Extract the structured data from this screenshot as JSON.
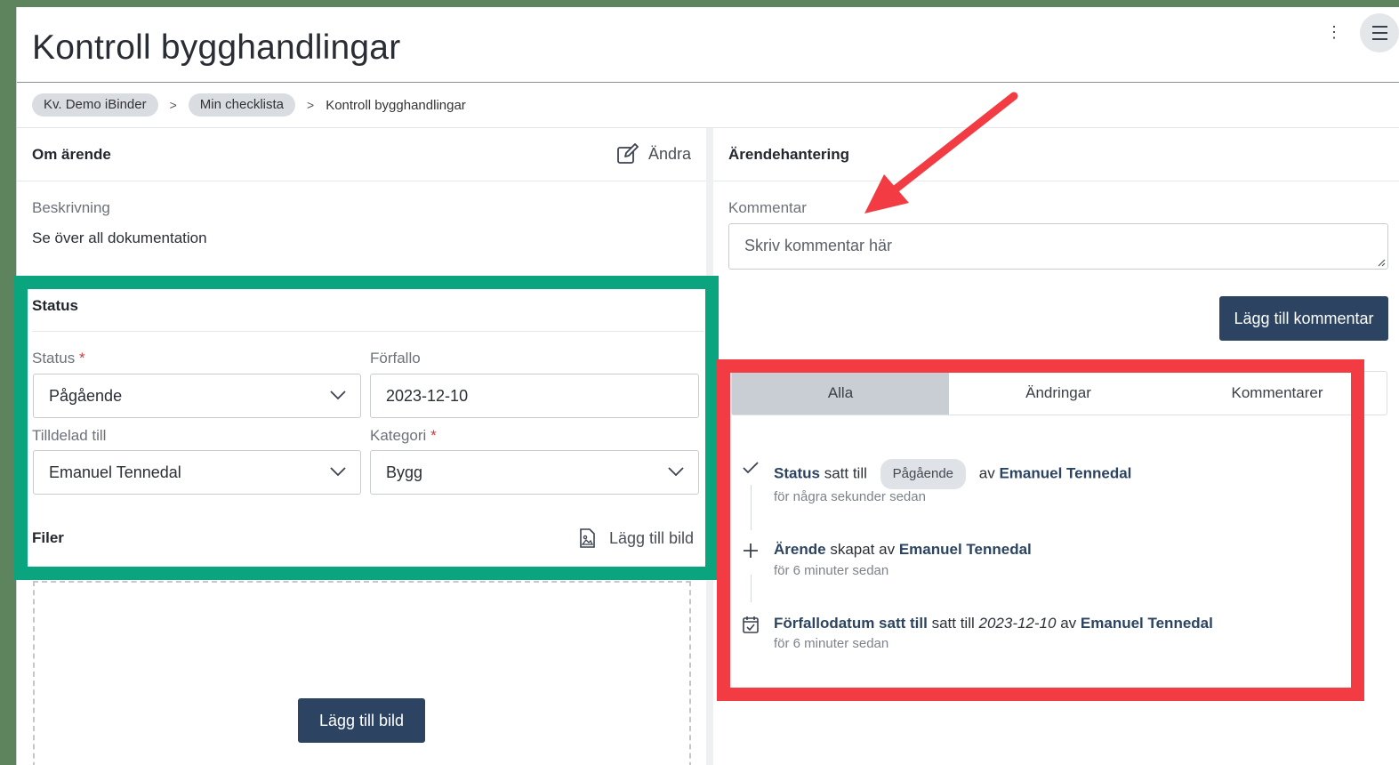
{
  "header": {
    "title": "Kontroll bygghandlingar",
    "more_icon_glyph": "⋮"
  },
  "breadcrumb": {
    "items": [
      "Kv. Demo iBinder",
      "Min checklista"
    ],
    "current": "Kontroll bygghandlingar",
    "separator": ">"
  },
  "about": {
    "heading": "Om ärende",
    "edit_label": "Ändra",
    "description_label": "Beskrivning",
    "description_value": "Se över all dokumentation"
  },
  "status_section": {
    "heading": "Status",
    "status_label": "Status",
    "status_value": "Pågående",
    "due_label": "Förfallo",
    "due_value": "2023-12-10",
    "assigned_label": "Tilldelad till",
    "assigned_value": "Emanuel Tennedal",
    "category_label": "Kategori",
    "category_value": "Bygg",
    "required_mark": "*"
  },
  "files": {
    "heading": "Filer",
    "add_image_link": "Lägg till bild",
    "add_image_button": "Lägg till bild"
  },
  "case_handling": {
    "heading": "Ärendehantering",
    "comment_label": "Kommentar",
    "comment_placeholder": "Skriv kommentar här",
    "add_comment_button": "Lägg till kommentar"
  },
  "tabs": [
    "Alla",
    "Ändringar",
    "Kommentarer"
  ],
  "activity": [
    {
      "icon": "check-icon",
      "subject": "Status",
      "verb": "satt till",
      "badge": "Pågående",
      "by_prefix": "av",
      "user": "Emanuel Tennedal",
      "time": "för några sekunder sedan"
    },
    {
      "icon": "plus-icon",
      "subject": "Ärende",
      "verb": "skapat av",
      "user": "Emanuel Tennedal",
      "time": "för 6 minuter sedan"
    },
    {
      "icon": "calendar-check-icon",
      "subject": "Förfallodatum satt till",
      "verb": "satt till",
      "value": "2023-12-10",
      "by_prefix": "av",
      "user": "Emanuel Tennedal",
      "time": "för 6 minuter sedan"
    }
  ],
  "colors": {
    "primary_button": "#2c4462",
    "highlight_green": "#0aa47e",
    "highlight_red": "#f23b42",
    "window_background": "#5d845c"
  }
}
